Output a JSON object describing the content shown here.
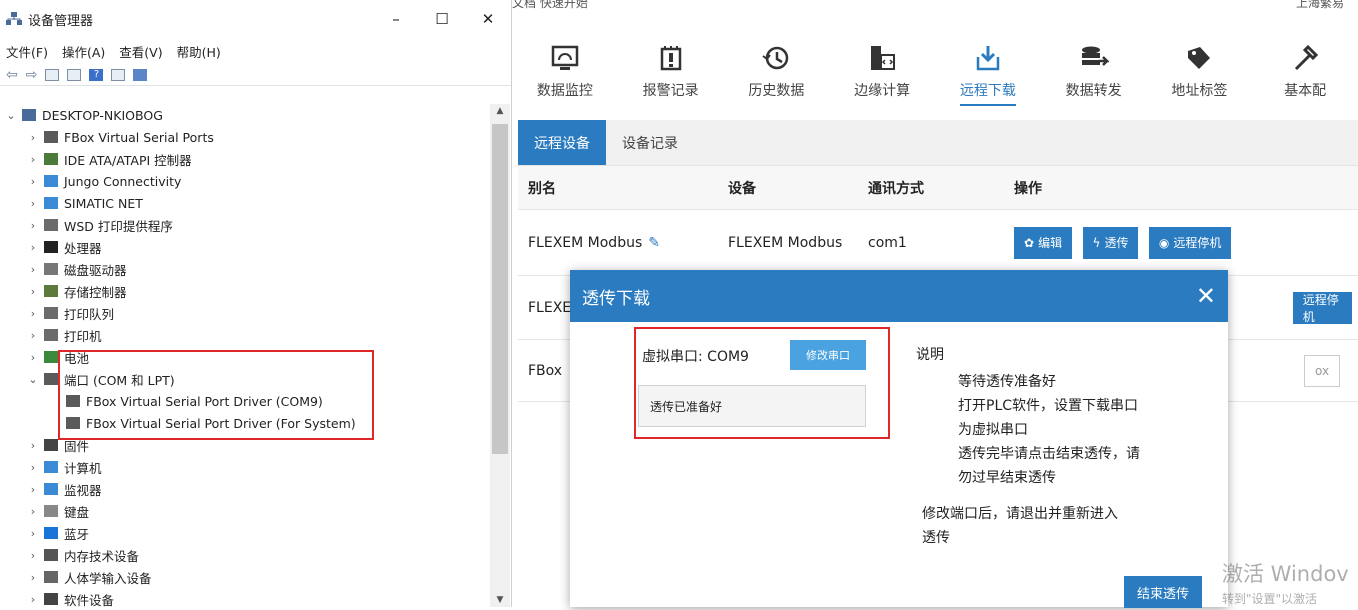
{
  "device_manager": {
    "title": "设备管理器",
    "window_controls": [
      "–",
      "☐",
      "✕"
    ],
    "menu": [
      "文件(F)",
      "操作(A)",
      "查看(V)",
      "帮助(H)"
    ],
    "root": "DESKTOP-NKIOBOG",
    "tree": [
      {
        "label": "FBox Virtual Serial Ports",
        "icon": "port-icon"
      },
      {
        "label": "IDE ATA/ATAPI 控制器",
        "icon": "ide-controller-icon"
      },
      {
        "label": "Jungo Connectivity",
        "icon": "monitor-icon"
      },
      {
        "label": "SIMATIC NET",
        "icon": "monitor-icon"
      },
      {
        "label": "WSD 打印提供程序",
        "icon": "printer-icon"
      },
      {
        "label": "处理器",
        "icon": "cpu-icon"
      },
      {
        "label": "磁盘驱动器",
        "icon": "disk-icon"
      },
      {
        "label": "存储控制器",
        "icon": "storage-icon"
      },
      {
        "label": "打印队列",
        "icon": "printer-icon"
      },
      {
        "label": "打印机",
        "icon": "printer-icon"
      },
      {
        "label": "电池",
        "icon": "battery-icon"
      },
      {
        "label": "端口 (COM 和 LPT)",
        "icon": "port-icon",
        "expanded": true
      },
      {
        "label": "FBox Virtual Serial Port Driver (COM9)",
        "icon": "port-icon",
        "child": true
      },
      {
        "label": "FBox Virtual Serial Port Driver (For System)",
        "icon": "port-icon",
        "child": true
      },
      {
        "label": "固件",
        "icon": "firmware-icon"
      },
      {
        "label": "计算机",
        "icon": "monitor-icon"
      },
      {
        "label": "监视器",
        "icon": "monitor-icon"
      },
      {
        "label": "键盘",
        "icon": "keyboard-icon"
      },
      {
        "label": "蓝牙",
        "icon": "bluetooth-icon"
      },
      {
        "label": "内存技术设备",
        "icon": "memory-icon"
      },
      {
        "label": "人体学输入设备",
        "icon": "hid-icon"
      },
      {
        "label": "软件设备",
        "icon": "software-icon"
      }
    ]
  },
  "app": {
    "top_strip_left": "文档 快速开始",
    "top_strip_right": [
      "上海繁易"
    ],
    "nav": [
      {
        "label": "数据监控",
        "icon": "monitor-data-icon"
      },
      {
        "label": "报警记录",
        "icon": "alarm-icon"
      },
      {
        "label": "历史数据",
        "icon": "history-icon"
      },
      {
        "label": "边缘计算",
        "icon": "edge-compute-icon"
      },
      {
        "label": "远程下载",
        "icon": "remote-download-icon",
        "active": true
      },
      {
        "label": "数据转发",
        "icon": "data-forward-icon"
      },
      {
        "label": "地址标签",
        "icon": "address-tag-icon"
      },
      {
        "label": "基本配",
        "icon": "tools-icon"
      }
    ],
    "tabs": [
      "远程设备",
      "设备记录"
    ],
    "table_headers": [
      "别名",
      "设备",
      "通讯方式",
      "操作"
    ],
    "rows": [
      {
        "alias": "FLEXEM Modbus",
        "device": "FLEXEM Modbus",
        "comm": "com1"
      },
      {
        "alias": "FLEXE",
        "device": "",
        "comm": ""
      },
      {
        "alias": "FBox",
        "device": "",
        "comm": ""
      }
    ],
    "actions": {
      "edit": "编辑",
      "passthrough": "透传",
      "remote_stop": "远程停机",
      "box_text": "ox"
    },
    "accent_color": "#2b7bc0"
  },
  "dialog": {
    "title": "透传下载",
    "close": "✕",
    "virtual_port_label": "虚拟串口: COM9",
    "modify_button": "修改串口",
    "status_text": "透传已准备好",
    "info_title": "说明",
    "info_lines": [
      "等待透传准备好",
      "打开PLC软件，设置下载串口",
      "为虚拟串口",
      "透传完毕请点击结束透传，请",
      "勿过早结束透传"
    ],
    "info_note_lines": [
      "修改端口后，请退出并重新进入",
      "透传"
    ],
    "end_button": "结束透传"
  },
  "watermark": {
    "line1": "激活 Windov",
    "line2": "转到\"设置\"以激活"
  }
}
